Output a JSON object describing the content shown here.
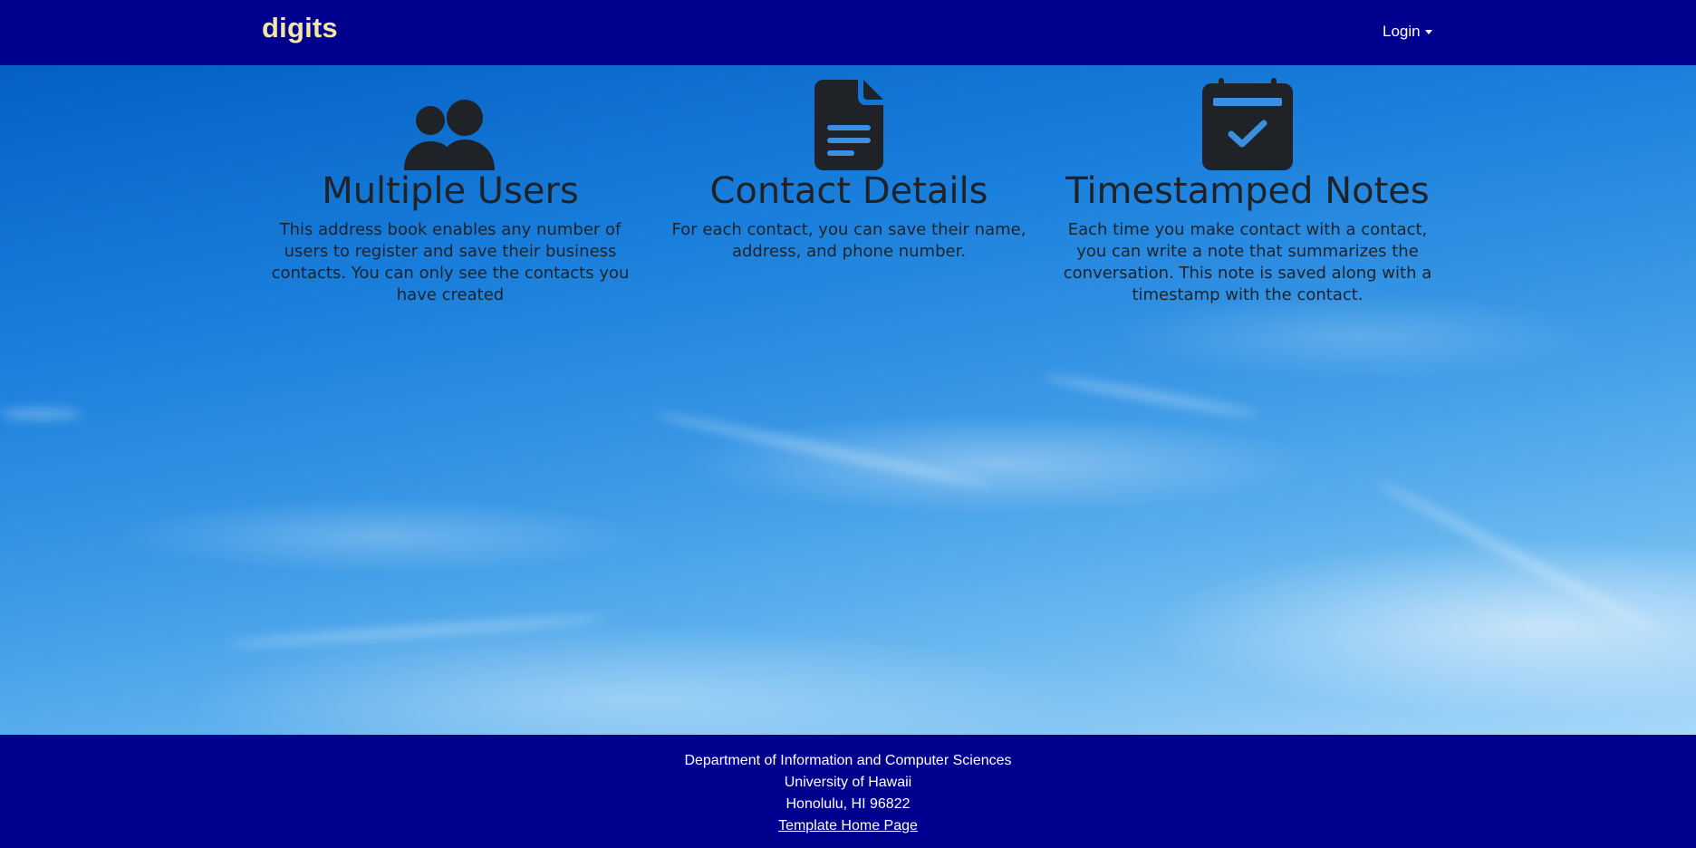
{
  "navbar": {
    "brand": "digits",
    "login_label": "Login"
  },
  "features": [
    {
      "icon": "users-icon",
      "title": "Multiple Users",
      "text": "This address book enables any number of users to register and save their business contacts. You can only see the contacts you have created"
    },
    {
      "icon": "file-lines-icon",
      "title": "Contact Details",
      "text": "For each contact, you can save their name, address, and phone number."
    },
    {
      "icon": "calendar-check-icon",
      "title": "Timestamped Notes",
      "text": "Each time you make contact with a contact, you can write a note that summarizes the conversation. This note is saved along with a timestamp with the contact."
    }
  ],
  "footer": {
    "department": "Department of Information and Computer Sciences",
    "university": "University of Hawaii",
    "location": "Honolulu, HI 96822",
    "link_label": "Template Home Page"
  },
  "colors": {
    "navbar_bg": "#00008f",
    "brand": "#f3e7a3",
    "text_dark": "#1f2328"
  }
}
